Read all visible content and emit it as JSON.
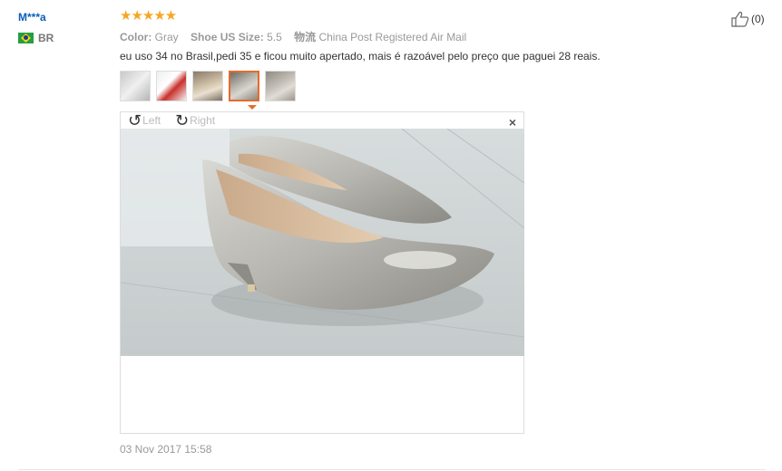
{
  "review": {
    "user": "M***a",
    "country": "BR",
    "stars": "★★★★★",
    "attrs": {
      "color_label": "Color:",
      "color_value": "Gray",
      "size_label": "Shoe US Size:",
      "size_value": "5.5",
      "shipping_label": "物流",
      "shipping_value": "China Post Registered Air Mail"
    },
    "text": "eu uso 34 no Brasil,pedi 35 e ficou muito apertado, mais é razoável pelo preço que paguei 28 reais.",
    "date": "03 Nov 2017 15:58",
    "helpful_count": "(0)",
    "rating": 5
  },
  "viewer": {
    "rotate_left": "Left",
    "rotate_right": "Right",
    "close": "×",
    "selected_thumb": 4
  },
  "icons": {
    "rotate_left": "rotate-left-icon",
    "rotate_right": "rotate-right-icon",
    "thumb_up": "thumb-up-icon",
    "flag": "brazil-flag-icon"
  },
  "colors": {
    "star": "#f5a623",
    "user_link": "#0b5db7",
    "active_thumb": "#e46c2b"
  }
}
